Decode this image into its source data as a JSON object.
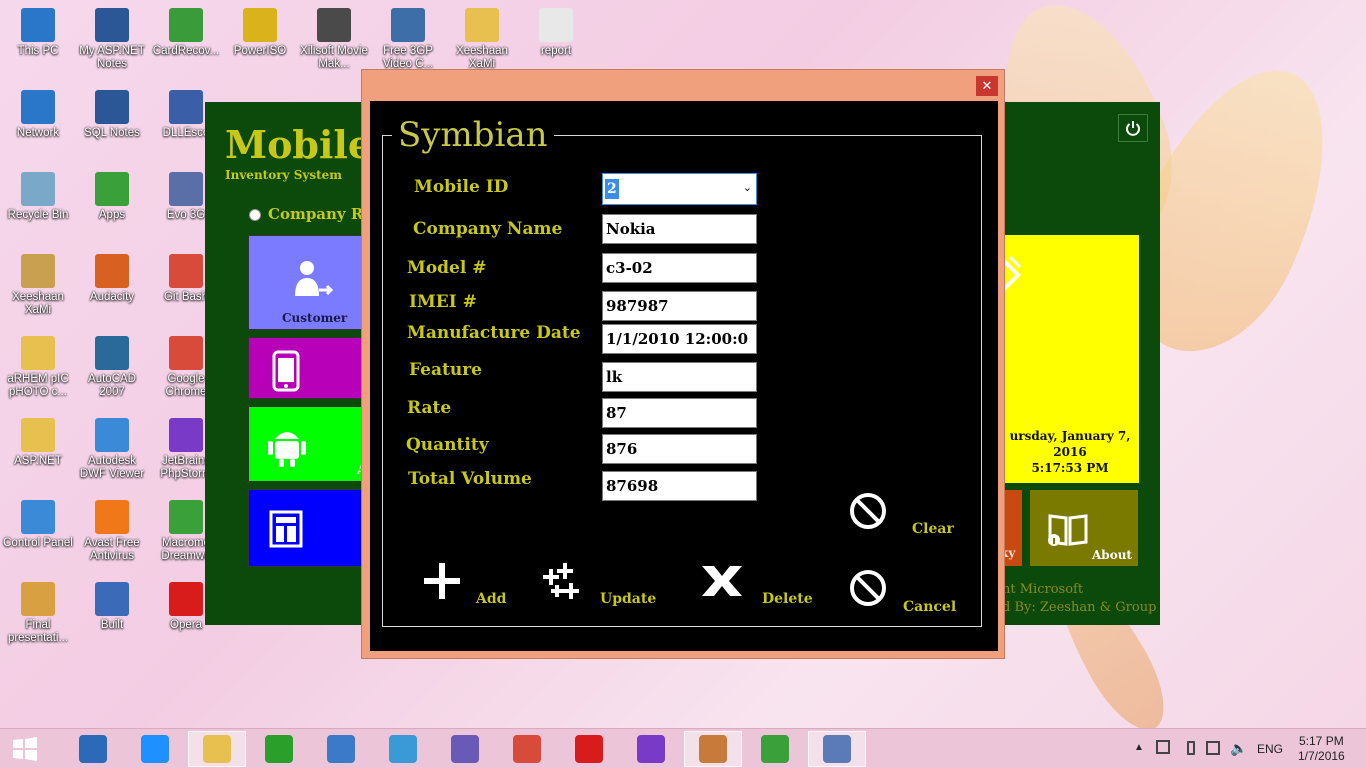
{
  "desktop": {
    "icons": [
      {
        "label": "This PC",
        "icon": "computer-icon",
        "color": "#2a76c9"
      },
      {
        "label": "My ASP.NET Notes",
        "icon": "word-doc-icon",
        "color": "#2b5797"
      },
      {
        "label": "CardRecov...",
        "icon": "shortcut-app-icon",
        "color": "#3a9b3a"
      },
      {
        "label": "PowerISO",
        "icon": "disc-icon",
        "color": "#d9b21c"
      },
      {
        "label": "Xilisoft Movie Mak...",
        "icon": "film-icon",
        "color": "#4a4a4a"
      },
      {
        "label": "Free 3GP Video C...",
        "icon": "phone-icon",
        "color": "#3d6ea8"
      },
      {
        "label": "Xeeshaan XaMi",
        "icon": "folder-icon",
        "color": "#e8c050"
      },
      {
        "label": "report",
        "icon": "document-icon",
        "color": "#e8e8e8"
      },
      {
        "label": "Network",
        "icon": "network-icon",
        "color": "#2a76c9"
      },
      {
        "label": "SQL Notes",
        "icon": "word-doc-icon",
        "color": "#2b5797"
      },
      {
        "label": "DLLEsco",
        "icon": "shortcut-app-icon",
        "color": "#3a5fa8"
      },
      {
        "label": "Recycle Bin",
        "icon": "recycle-bin-icon",
        "color": "#7aa8c8"
      },
      {
        "label": "Apps",
        "icon": "apps-icon",
        "color": "#3aa03a"
      },
      {
        "label": "Evo 3G",
        "icon": "shortcut-app-icon",
        "color": "#5a6fa8"
      },
      {
        "label": "Xeeshaan XaMi",
        "icon": "user-icon",
        "color": "#c8a050"
      },
      {
        "label": "Audacity",
        "icon": "headphones-icon",
        "color": "#d86020"
      },
      {
        "label": "Git Bash",
        "icon": "git-icon",
        "color": "#d84a3a"
      },
      {
        "label": "aRHEM pIC pHOTO c...",
        "icon": "folder-icon",
        "color": "#e8c050"
      },
      {
        "label": "AutoCAD 2007",
        "icon": "autocad-icon",
        "color": "#2a6a9a"
      },
      {
        "label": "Google Chrome",
        "icon": "chrome-icon",
        "color": "#d84a3a"
      },
      {
        "label": "ASP.NET",
        "icon": "folder-icon",
        "color": "#e8c050"
      },
      {
        "label": "Autodesk DWF Viewer",
        "icon": "autodesk-icon",
        "color": "#3a8ad8"
      },
      {
        "label": "JetBrains PhpStorm",
        "icon": "phpstorm-icon",
        "color": "#7a3ac8"
      },
      {
        "label": "Control Panel",
        "icon": "control-panel-icon",
        "color": "#3a8ad8"
      },
      {
        "label": "Avast Free Antivirus",
        "icon": "avast-icon",
        "color": "#f07818"
      },
      {
        "label": "Macrome Dreamwe",
        "icon": "dreamweaver-icon",
        "color": "#3aa03a"
      },
      {
        "label": "Final presentati...",
        "icon": "presentation-icon",
        "color": "#d8a040"
      },
      {
        "label": "Built",
        "icon": "build-icon",
        "color": "#3a6ab8"
      },
      {
        "label": "Opera",
        "icon": "opera-icon",
        "color": "#d81c1c"
      }
    ]
  },
  "main_app": {
    "title": "Mobile",
    "subtitle": "Inventory System",
    "radio_label": "Company Rec",
    "tiles": {
      "customer_label": "Customer",
      "about_label": "About",
      "other_partial": "A",
      "partial_ky": "ky"
    },
    "clock": {
      "day_line": "ursday, January 7,",
      "year_line": "2016",
      "time_line": "5:17:53 PM"
    },
    "footer": {
      "line1": "nt Microsoft",
      "line2": "d By: Zeeshan & Group"
    },
    "colors": {
      "background": "#0b4a0b",
      "accent": "#c8c81a",
      "customer_tile": "#7b7bff",
      "mobile_tile": "#b800b8",
      "android_tile": "#00ff00",
      "blue_tile": "#0000ff",
      "yellow_tile": "#ffff00",
      "orange_tile": "#c84a10",
      "about_tile": "#7a7a00"
    }
  },
  "dialog": {
    "group_title": "Symbian",
    "fields": [
      {
        "label": "Mobile ID",
        "value": "2",
        "type": "select"
      },
      {
        "label": "Company Name",
        "value": "Nokia"
      },
      {
        "label": "Model #",
        "value": "c3-02"
      },
      {
        "label": "IMEI #",
        "value": "987987"
      },
      {
        "label": "Manufacture Date",
        "value": "1/1/2010 12:00:0"
      },
      {
        "label": "Feature",
        "value": "lk"
      },
      {
        "label": "Rate",
        "value": "87"
      },
      {
        "label": "Quantity",
        "value": "876"
      },
      {
        "label": "Total Volume",
        "value": "87698"
      }
    ],
    "buttons": {
      "add": "Add",
      "update": "Update",
      "delete": "Delete",
      "clear": "Clear",
      "cancel": "Cancel"
    },
    "close_glyph": "✕",
    "colors": {
      "frame": "#f0a07c",
      "body": "#000000",
      "label": "#c8c81a",
      "close": "#c7362f"
    }
  },
  "taskbar": {
    "items": [
      {
        "icon": "start-icon"
      },
      {
        "icon": "intel-graphics-icon"
      },
      {
        "icon": "internet-explorer-icon"
      },
      {
        "icon": "file-explorer-icon"
      },
      {
        "icon": "store-icon"
      },
      {
        "icon": "control-panel-icon"
      },
      {
        "icon": "spiral-app-icon"
      },
      {
        "icon": "hexagon-app-icon"
      },
      {
        "icon": "chrome-icon"
      },
      {
        "icon": "opera-icon"
      },
      {
        "icon": "visual-studio-icon"
      },
      {
        "icon": "paint-icon"
      },
      {
        "icon": "bluestacks-icon"
      },
      {
        "icon": "window-app-icon"
      }
    ],
    "language": "ENG",
    "time": "5:17 PM",
    "date": "1/7/2016"
  }
}
